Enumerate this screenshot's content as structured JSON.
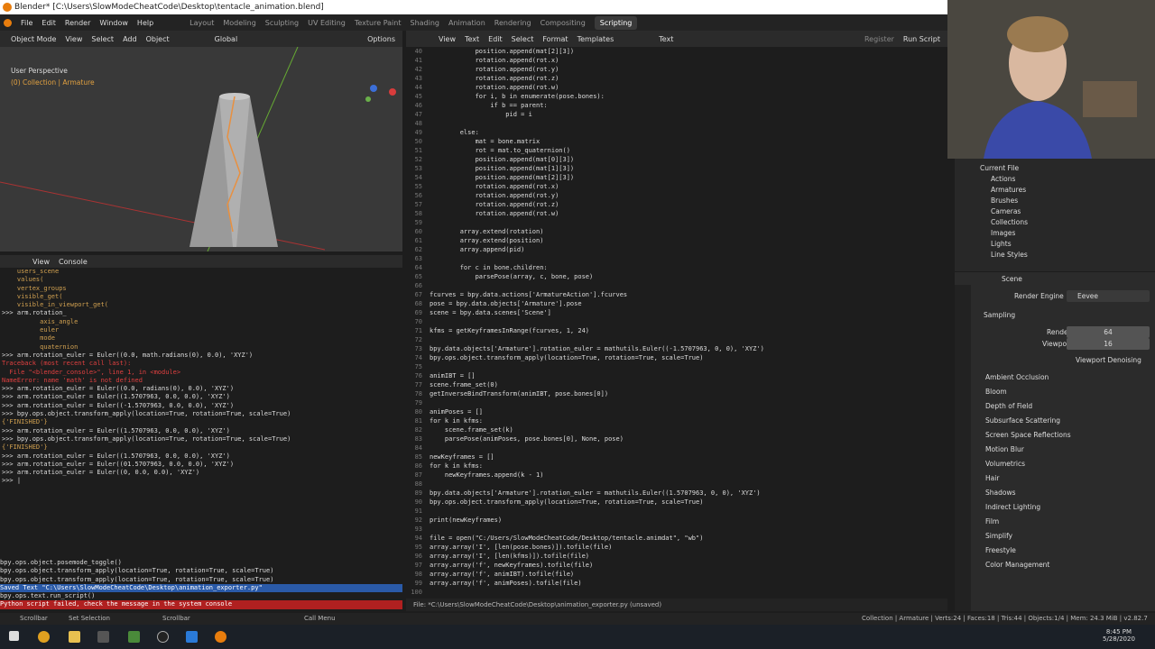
{
  "window": {
    "title": "Blender* [C:\\Users\\SlowModeCheatCode\\Desktop\\tentacle_animation.blend]"
  },
  "menu": [
    "File",
    "Edit",
    "Render",
    "Window",
    "Help"
  ],
  "workspaces": [
    "Layout",
    "Modeling",
    "Sculpting",
    "UV Editing",
    "Texture Paint",
    "Shading",
    "Animation",
    "Rendering",
    "Compositing",
    "Scripting"
  ],
  "active_workspace": "Scripting",
  "viewport": {
    "mode": "Object Mode",
    "menus": [
      "View",
      "Select",
      "Add",
      "Object"
    ],
    "transform": "Global",
    "options": "Options",
    "persp": "User Perspective",
    "collection": "(0) Collection | Armature"
  },
  "console_header": {
    "view": "View",
    "console": "Console"
  },
  "console_lines": [
    {
      "t": "    users_scene",
      "c": "#d0a050"
    },
    {
      "t": "    values(",
      "c": "#d0a050"
    },
    {
      "t": "    vertex_groups",
      "c": "#d0a050"
    },
    {
      "t": "    visible_get(",
      "c": "#d0a050"
    },
    {
      "t": "    visible_in_viewport_get(",
      "c": "#d0a050"
    },
    {
      "t": ">>> arm.rotation_",
      "c": "#ddd"
    },
    {
      "t": "          axis_angle",
      "c": "#d0a050"
    },
    {
      "t": "          euler",
      "c": "#d0a050"
    },
    {
      "t": "          mode",
      "c": "#d0a050"
    },
    {
      "t": "          quaternion",
      "c": "#d0a050"
    },
    {
      "t": ">>> arm.rotation_euler = Euler((0.0, math.radians(0), 0.0), 'XYZ')",
      "c": "#ddd"
    },
    {
      "t": "Traceback (most recent call last):",
      "c": "#e04040"
    },
    {
      "t": "  File \"<blender_console>\", line 1, in <module>",
      "c": "#e04040"
    },
    {
      "t": "NameError: name 'math' is not defined",
      "c": "#e04040"
    },
    {
      "t": "",
      "c": "#ddd"
    },
    {
      "t": ">>> arm.rotation_euler = Euler((0.0, radians(0), 0.0), 'XYZ')",
      "c": "#ddd"
    },
    {
      "t": ">>> arm.rotation_euler = Euler((1.5707963, 0.0, 0.0), 'XYZ')",
      "c": "#ddd"
    },
    {
      "t": ">>> arm.rotation_euler = Euler((-1.5707963, 0.0, 0.0), 'XYZ')",
      "c": "#ddd"
    },
    {
      "t": ">>> bpy.ops.object.transform_apply(location=True, rotation=True, scale=True)",
      "c": "#ddd"
    },
    {
      "t": "{'FINISHED'}",
      "c": "#d0a050"
    },
    {
      "t": "",
      "c": "#ddd"
    },
    {
      "t": ">>> arm.rotation_euler = Euler((1.5707963, 0.0, 0.0), 'XYZ')",
      "c": "#ddd"
    },
    {
      "t": ">>> bpy.ops.object.transform_apply(location=True, rotation=True, scale=True)",
      "c": "#ddd"
    },
    {
      "t": "{'FINISHED'}",
      "c": "#d0a050"
    },
    {
      "t": "",
      "c": "#ddd"
    },
    {
      "t": ">>> arm.rotation_euler = Euler((1.5707963, 0.0, 0.0), 'XYZ')",
      "c": "#ddd"
    },
    {
      "t": ">>> arm.rotation_euler = Euler((01.5707963, 0.0, 0.0), 'XYZ')",
      "c": "#ddd"
    },
    {
      "t": ">>> arm.rotation_euler = Euler((0, 0.0, 0.0), 'XYZ')",
      "c": "#ddd"
    },
    {
      "t": ">>> |",
      "c": "#ddd"
    }
  ],
  "info_lines": [
    {
      "t": "bpy.ops.object.posemode_toggle()",
      "c": "#ddd",
      "bg": ""
    },
    {
      "t": "bpy.ops.object.transform_apply(location=True, rotation=True, scale=True)",
      "c": "#ddd",
      "bg": ""
    },
    {
      "t": "bpy.ops.object.transform_apply(location=True, rotation=True, scale=True)",
      "c": "#ddd",
      "bg": ""
    },
    {
      "t": "Saved Text \"C:\\Users\\SlowModeCheatCode\\Desktop\\animation_exporter.py\"",
      "c": "#fff",
      "bg": "#2a5aa8"
    },
    {
      "t": "bpy.ops.text.run_script()",
      "c": "#ddd",
      "bg": ""
    },
    {
      "t": "Python script failed, check the message in the system console",
      "c": "#fff",
      "bg": "#b02020"
    }
  ],
  "text_editor": {
    "menus": [
      "View",
      "Text",
      "Edit",
      "Select",
      "Format",
      "Templates"
    ],
    "name": "Text",
    "run": "Run Script",
    "register": "Register"
  },
  "code": [
    {
      "n": "40",
      "t": "            position.append(mat[2][3])"
    },
    {
      "n": "41",
      "t": "            rotation.append(rot.x)"
    },
    {
      "n": "42",
      "t": "            rotation.append(rot.y)"
    },
    {
      "n": "43",
      "t": "            rotation.append(rot.z)"
    },
    {
      "n": "44",
      "t": "            rotation.append(rot.w)"
    },
    {
      "n": "45",
      "t": "            for i, b in enumerate(pose.bones):"
    },
    {
      "n": "46",
      "t": "                if b == parent:"
    },
    {
      "n": "47",
      "t": "                    pid = i"
    },
    {
      "n": "48",
      "t": ""
    },
    {
      "n": "49",
      "t": "        else:"
    },
    {
      "n": "50",
      "t": "            mat = bone.matrix"
    },
    {
      "n": "51",
      "t": "            rot = mat.to_quaternion()"
    },
    {
      "n": "52",
      "t": "            position.append(mat[0][3])"
    },
    {
      "n": "53",
      "t": "            position.append(mat[1][3])"
    },
    {
      "n": "54",
      "t": "            position.append(mat[2][3])"
    },
    {
      "n": "55",
      "t": "            rotation.append(rot.x)"
    },
    {
      "n": "56",
      "t": "            rotation.append(rot.y)"
    },
    {
      "n": "57",
      "t": "            rotation.append(rot.z)"
    },
    {
      "n": "58",
      "t": "            rotation.append(rot.w)"
    },
    {
      "n": "59",
      "t": ""
    },
    {
      "n": "60",
      "t": "        array.extend(rotation)"
    },
    {
      "n": "61",
      "t": "        array.extend(position)"
    },
    {
      "n": "62",
      "t": "        array.append(pid)"
    },
    {
      "n": "63",
      "t": ""
    },
    {
      "n": "64",
      "t": "        for c in bone.children:"
    },
    {
      "n": "65",
      "t": "            parsePose(array, c, bone, pose)"
    },
    {
      "n": "66",
      "t": ""
    },
    {
      "n": "67",
      "t": "fcurves = bpy.data.actions['ArmatureAction'].fcurves"
    },
    {
      "n": "68",
      "t": "pose = bpy.data.objects['Armature'].pose"
    },
    {
      "n": "69",
      "t": "scene = bpy.data.scenes['Scene']"
    },
    {
      "n": "70",
      "t": ""
    },
    {
      "n": "71",
      "t": "kfms = getKeyframesInRange(fcurves, 1, 24)"
    },
    {
      "n": "72",
      "t": ""
    },
    {
      "n": "73",
      "t": "bpy.data.objects['Armature'].rotation_euler = mathutils.Euler((-1.5707963, 0, 0), 'XYZ')"
    },
    {
      "n": "74",
      "t": "bpy.ops.object.transform_apply(location=True, rotation=True, scale=True)"
    },
    {
      "n": "75",
      "t": ""
    },
    {
      "n": "76",
      "t": "animIBT = []"
    },
    {
      "n": "77",
      "t": "scene.frame_set(0)"
    },
    {
      "n": "78",
      "t": "getInverseBindTransform(animIBT, pose.bones[0])"
    },
    {
      "n": "79",
      "t": ""
    },
    {
      "n": "80",
      "t": "animPoses = []"
    },
    {
      "n": "81",
      "t": "for k in kfms:"
    },
    {
      "n": "82",
      "t": "    scene.frame_set(k)"
    },
    {
      "n": "83",
      "t": "    parsePose(animPoses, pose.bones[0], None, pose)"
    },
    {
      "n": "84",
      "t": ""
    },
    {
      "n": "85",
      "t": "newKeyframes = []"
    },
    {
      "n": "86",
      "t": "for k in kfms:"
    },
    {
      "n": "87",
      "t": "    newKeyframes.append(k - 1)"
    },
    {
      "n": "88",
      "t": ""
    },
    {
      "n": "89",
      "t": "bpy.data.objects['Armature'].rotation_euler = mathutils.Euler((1.5707963, 0, 0), 'XYZ')"
    },
    {
      "n": "90",
      "t": "bpy.ops.object.transform_apply(location=True, rotation=True, scale=True)"
    },
    {
      "n": "91",
      "t": ""
    },
    {
      "n": "92",
      "t": "print(newKeyframes)"
    },
    {
      "n": "93",
      "t": ""
    },
    {
      "n": "94",
      "t": "file = open(\"C:/Users/SlowModeCheatCode/Desktop/tentacle.animdat\", \"wb\")"
    },
    {
      "n": "95",
      "t": "array.array('I', [len(pose.bones)]).tofile(file)"
    },
    {
      "n": "96",
      "t": "array.array('I', [len(kfms)]).tofile(file)"
    },
    {
      "n": "97",
      "t": "array.array('f', newKeyframes).tofile(file)"
    },
    {
      "n": "98",
      "t": "array.array('f', animIBT).tofile(file)"
    },
    {
      "n": "99",
      "t": "array.array('f', animPoses).tofile(file)"
    },
    {
      "n": "100",
      "t": ""
    }
  ],
  "text_footer": "File: *C:\\Users\\SlowModeCheatCode\\Desktop\\animation_exporter.py (unsaved)",
  "outliner": {
    "root": "Current File",
    "items": [
      "Actions",
      "Armatures",
      "Brushes",
      "Cameras",
      "Collections",
      "Images",
      "Lights",
      "Line Styles"
    ]
  },
  "properties": {
    "scene": "Scene",
    "render_engine_label": "Render Engine",
    "render_engine": "Eevee",
    "sampling": "Sampling",
    "render_label": "Render",
    "render_val": "64",
    "viewport_label": "Viewport",
    "viewport_val": "16",
    "denoise": "Viewport Denoising",
    "panels": [
      "Ambient Occlusion",
      "Bloom",
      "Depth of Field",
      "Subsurface Scattering",
      "Screen Space Reflections",
      "Motion Blur",
      "Volumetrics",
      "Hair",
      "Shadows",
      "Indirect Lighting",
      "Film",
      "Simplify",
      "Freestyle",
      "Color Management"
    ]
  },
  "status": {
    "scrollbar": "Scrollbar",
    "set_selection": "Set Selection",
    "scrollbar2": "Scrollbar",
    "call_menu": "Call Menu",
    "stats": "Collection | Armature | Verts:24 | Faces:18 | Tris:44 | Objects:1/4 | Mem: 24.3 MiB | v2.82.7"
  },
  "clock": {
    "time": "8:45 PM",
    "date": "5/28/2020"
  }
}
